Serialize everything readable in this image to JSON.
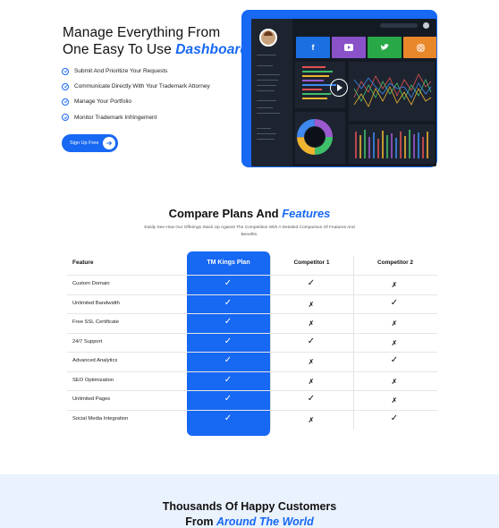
{
  "hero": {
    "title_line1": "Manage Everything From",
    "title_line2_prefix": "One Easy To Use ",
    "title_line2_accent": "Dashboard",
    "features": [
      "Submit And Prioritize Your Requests",
      "Communicate Directly With Your Trademark Attorney",
      "Manage Your Portfolio",
      "Monitor Trademark Infringement"
    ],
    "cta_label": "Sign Up Free",
    "dashboard_video_label": "Dashboard preview video"
  },
  "compare": {
    "title_prefix": "Compare Plans And ",
    "title_accent": "Features",
    "subtitle": "Easily See How Our Offerings Stack Up Against The Competition With A Detailed Comparison Of Features And Benefits.",
    "headers": [
      "Feature",
      "TM Kings Plan",
      "Competitor 1",
      "Competitor 2"
    ],
    "rows": [
      {
        "feature": "Custom Domain",
        "plan": "✓",
        "c1": "✓",
        "c2": "✗"
      },
      {
        "feature": "Unlimited Bandwidth",
        "plan": "✓",
        "c1": "✗",
        "c2": "✓"
      },
      {
        "feature": "Free SSL Certificate",
        "plan": "✓",
        "c1": "✗",
        "c2": "✗"
      },
      {
        "feature": "24/7 Support",
        "plan": "✓",
        "c1": "✓",
        "c2": "✗"
      },
      {
        "feature": "Advanced Analytics",
        "plan": "✓",
        "c1": "✗",
        "c2": "✓"
      },
      {
        "feature": "SEO Optimization",
        "plan": "✓",
        "c1": "✗",
        "c2": "✗"
      },
      {
        "feature": "Unlimited Pages",
        "plan": "✓",
        "c1": "✓",
        "c2": "✗"
      },
      {
        "feature": "Social Media Integration",
        "plan": "✓",
        "c1": "✗",
        "c2": "✓"
      }
    ]
  },
  "testimonials": {
    "title_line1": "Thousands Of Happy Customers",
    "title_line2_prefix": "From ",
    "title_line2_accent": "Around The World"
  },
  "colors": {
    "accent": "#1768f3",
    "dashboard_bg": "#141a24",
    "testimonial_bg": "#eaf2fe"
  }
}
